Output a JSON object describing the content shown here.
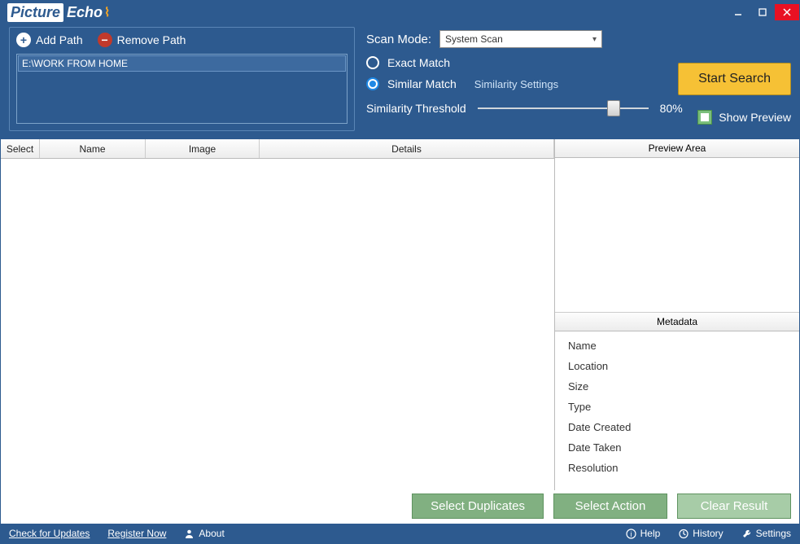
{
  "app": {
    "name_part1": "Picture",
    "name_part2": "Echo"
  },
  "paths": {
    "add_label": "Add Path",
    "remove_label": "Remove Path",
    "items": [
      "E:\\WORK FROM HOME"
    ]
  },
  "scan": {
    "mode_label": "Scan Mode:",
    "mode_value": "System Scan",
    "exact_label": "Exact Match",
    "similar_label": "Similar Match",
    "similarity_link": "Similarity Settings",
    "threshold_label": "Similarity Threshold",
    "threshold_value": "80%",
    "threshold_pct": 80,
    "start_label": "Start Search",
    "preview_label": "Show Preview",
    "selected_mode": "similar"
  },
  "columns": {
    "select": "Select",
    "name": "Name",
    "image": "Image",
    "details": "Details"
  },
  "preview": {
    "header": "Preview Area",
    "meta_header": "Metadata",
    "fields": [
      "Name",
      "Location",
      "Size",
      "Type",
      "Date Created",
      "Date Taken",
      "Resolution"
    ]
  },
  "actions": {
    "select_duplicates": "Select Duplicates",
    "select_action": "Select Action",
    "clear_result": "Clear Result"
  },
  "status": {
    "check_updates": "Check for Updates",
    "register": "Register Now",
    "about": "About",
    "help": "Help",
    "history": "History",
    "settings": "Settings"
  }
}
